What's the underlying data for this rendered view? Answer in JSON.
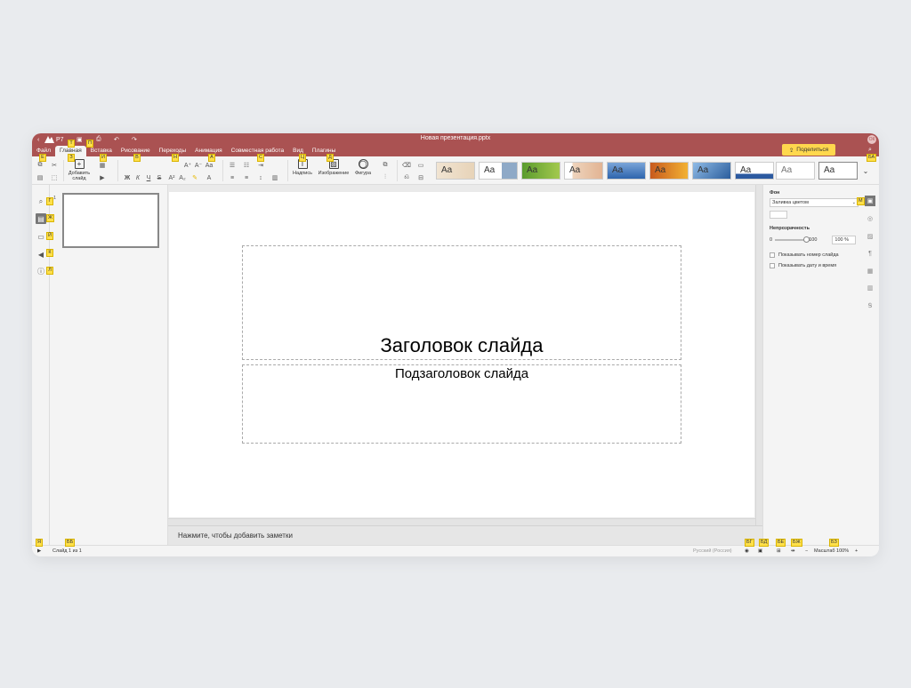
{
  "app": {
    "logo": "Р7",
    "doc_title": "Новая презентация.pptx",
    "avatar": "ОК"
  },
  "menu": {
    "items": [
      "Файл",
      "Главная",
      "Вставка",
      "Рисование",
      "Переходы",
      "Анимация",
      "Совместная работа",
      "Вид",
      "Плагины"
    ],
    "share_label": "Поделиться"
  },
  "toolbar": {
    "add_slide_line1": "Добавить",
    "add_slide_line2": "слайд",
    "textbox_label": "Надпись",
    "image_label": "Изображение",
    "shape_label": "Фигура",
    "bold": "Ж",
    "italic": "К",
    "underline": "Ч",
    "strike": "S",
    "theme_label": "Aa"
  },
  "slide": {
    "title": "Заголовок слайда",
    "subtitle": "Подзаголовок слайда",
    "thumb_number": "1"
  },
  "notes": {
    "placeholder": "Нажмите, чтобы добавить заметки"
  },
  "right_panel": {
    "bg_label": "Фон",
    "fill_value": "Заливка цветом",
    "opacity_label": "Непрозрачность",
    "opacity_min": "0",
    "opacity_max": "100",
    "opacity_value": "100 %",
    "opacity_fraction": 1.0,
    "show_slide_number": "Показывать номер слайда",
    "show_date": "Показывать дату и время"
  },
  "status": {
    "slide_of": "Слайд 1 из 1",
    "language": "Русский (Россия)",
    "zoom": "Масштаб 100%"
  },
  "keytips": {
    "file": "Е",
    "home": "З",
    "t": "Т",
    "p": "П",
    "insert": "И",
    "draw": "В",
    "trans": "Н",
    "anim": "А",
    "collab": "С",
    "view": "Ц",
    "plugins": "Д",
    "ba": "БА",
    "g": "Г",
    "zh": "Ж",
    "y": "Й",
    "k": "К",
    "l": "Л",
    "m": "М",
    "ya": "Я",
    "bb": "ББ",
    "bg": "БГ",
    "bd": "БД",
    "be": "БЕ",
    "bzh": "БЖ",
    "bz": "БЗ"
  },
  "colors": {
    "accent": "#aa5252",
    "share": "#ffd84d",
    "keytip": "#ffe04a"
  }
}
